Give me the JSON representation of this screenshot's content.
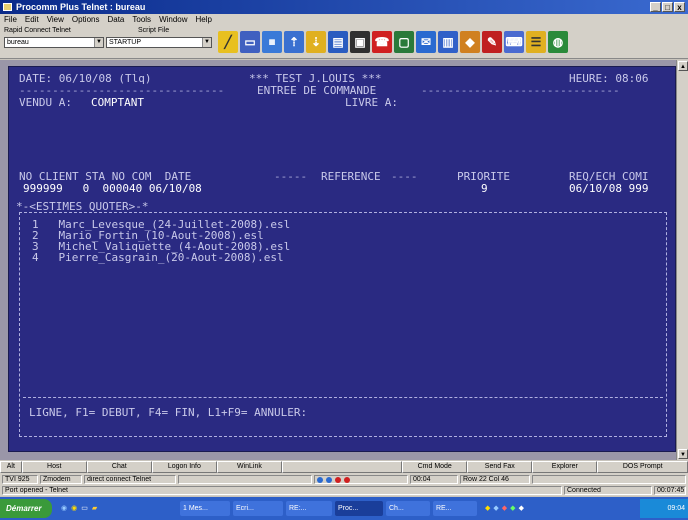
{
  "window": {
    "title": "Procomm Plus Telnet : bureau",
    "controls": [
      "_",
      "□",
      "x"
    ]
  },
  "menu": [
    "File",
    "Edit",
    "View",
    "Options",
    "Data",
    "Tools",
    "Window",
    "Help"
  ],
  "toolbar": {
    "rapid_connect_label": "Rapid Connect Telnet",
    "rapid_connect_value": "bureau",
    "script_label": "Script File",
    "script_value": "STARTUP",
    "icons": [
      "text-icon",
      "window-icon",
      "display-icon",
      "upload-icon",
      "download-icon",
      "scrollback-icon",
      "terminal-icon",
      "phone-icon",
      "monitor-icon",
      "fax-icon",
      "document-icon",
      "capture-icon",
      "chat-icon",
      "keyboard-icon",
      "settings-icon",
      "globe-icon"
    ]
  },
  "terminal": {
    "date_line": "DATE: 06/10/08 (Tlq)",
    "test_line": "*** TEST J.LOUIS ***",
    "heure": "HEURE: 08:06",
    "section_title": "ENTREE DE COMMANDE",
    "vendu_label": "VENDU A:",
    "vendu_value": "COMPTANT",
    "livre_label": "LIVRE A:",
    "header_row": "NO CLIENT STA NO COM  DATE",
    "reference_header": "REFERENCE",
    "priorite_header": "PRIORITE",
    "req_header": "REQ/ECH COMI",
    "data_row": "999999   0  000040 06/10/08",
    "priorite_value": "9",
    "req_value": "06/10/08 999",
    "estimes_title": "*-<ESTIMES QUOTER>-*",
    "estimes": [
      "1   Marc_Levesque_(24-Juillet-2008).esl",
      "2   Mario_Fortin_(10-Aout-2008).esl",
      "3   Michel_Valiquette_(4-Aout-2008).esl",
      "4   Pierre_Casgrain_(20-Aout-2008).esl"
    ],
    "command_line": "LIGNE, F1= DEBUT, F4= FIN, L1+F9= ANNULER:"
  },
  "fkeys": [
    "Alt",
    "Host",
    "Chat",
    "Logon Info",
    "WinLink",
    "",
    "Cmd Mode",
    "Send Fax",
    "Explorer",
    "DOS Prompt"
  ],
  "status1": {
    "emulation": "TVI 925",
    "mode": "Zmodem",
    "connection": "direct connect Telnet",
    "time": "00:04",
    "position": "Row 22 Col 46"
  },
  "status2": {
    "message": "Port opened - Telnet",
    "state": "Connected",
    "clock": "00:07:45"
  },
  "taskbar": {
    "start": "Démarrer",
    "tasks": [
      "1 Mes...",
      "Ecri...",
      "RE:...",
      "Proc...",
      "Ch...",
      "RE..."
    ],
    "tray_time": "09:04"
  }
}
